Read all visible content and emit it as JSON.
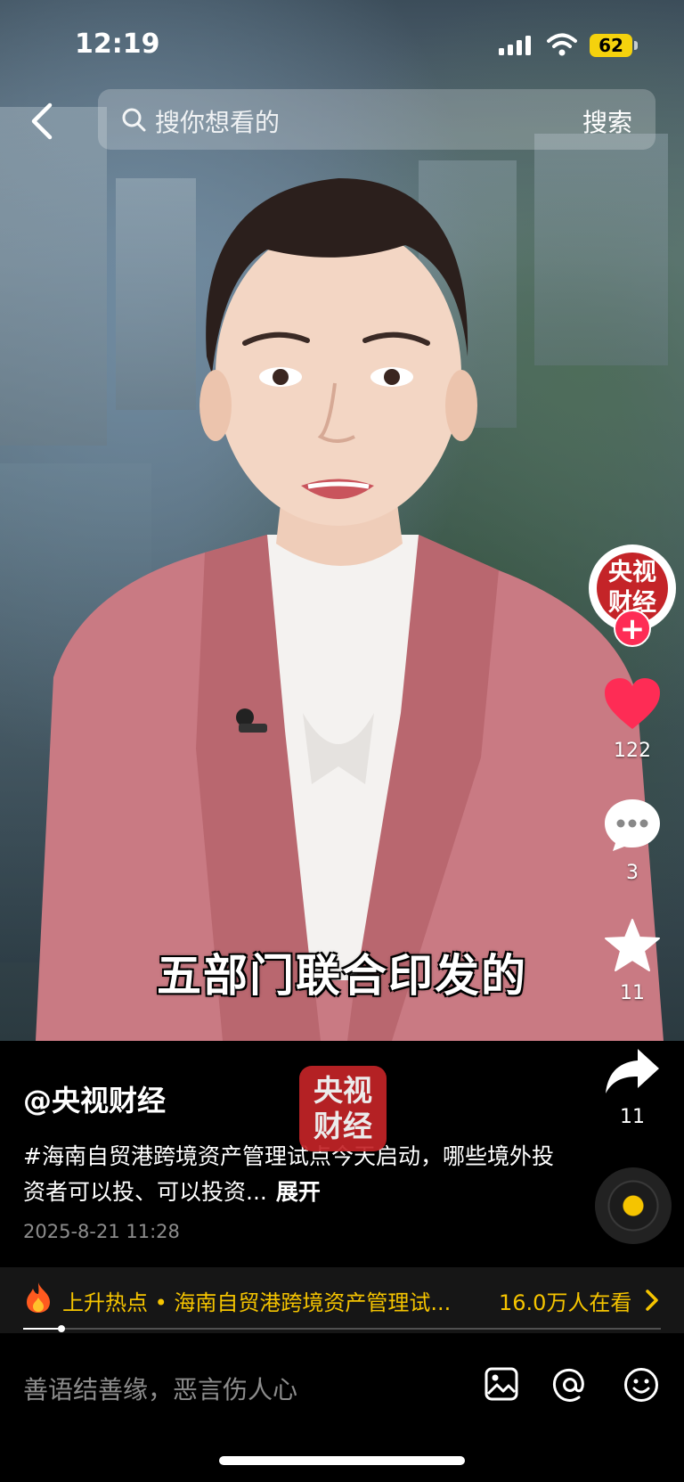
{
  "status_bar": {
    "time": "12:19",
    "battery": "62",
    "battery_color": "#f5d20d"
  },
  "search": {
    "placeholder": "搜你想看的",
    "button_label": "搜索"
  },
  "video": {
    "subtitle": "五部门联合印发的"
  },
  "channel": {
    "avatar_text": "央视财经",
    "watermark_text": "央视财经",
    "brand_color": "#c42428"
  },
  "rail": {
    "likes": "122",
    "comments": "3",
    "favorites": "11",
    "shares": "11",
    "like_color": "#fe2c55"
  },
  "caption": {
    "author": "@央视财经",
    "text": "#海南自贸港跨境资产管理试点今天启动，哪些境外投资者可以投、可以投资...",
    "expand_label": "展开",
    "post_time": "2025-8-21 11:28"
  },
  "hot_topic": {
    "text": "上升热点 • 海南自贸港跨境资产管理试...",
    "viewers": "16.0万人在看",
    "accent_color": "#f5c400"
  },
  "playback": {
    "progress": 0.06
  },
  "comment_input": {
    "placeholder": "善语结善缘，恶言伤人心"
  },
  "icons": [
    "back-arrow-icon",
    "search-icon",
    "heart-icon",
    "comment-bubble-icon",
    "star-icon",
    "share-arrow-icon",
    "music-disc-icon",
    "fire-icon",
    "chevron-right-icon",
    "image-icon",
    "at-icon",
    "emoji-icon"
  ]
}
